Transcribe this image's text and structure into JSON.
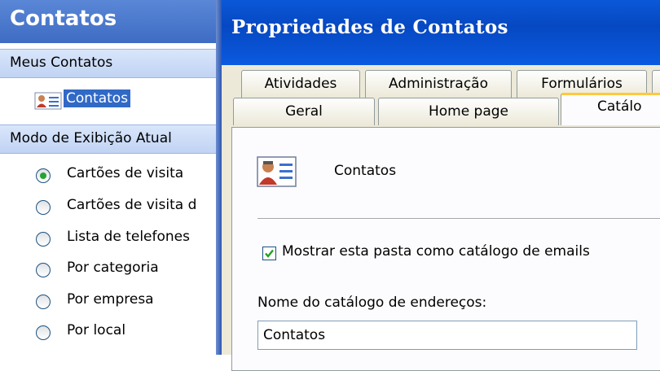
{
  "nav": {
    "title": "Contatos",
    "my_contacts_header": "Meus Contatos",
    "contacts_item": "Contatos",
    "current_view_header": "Modo de Exibição Atual",
    "views": [
      {
        "label": "Cartões de visita",
        "selected": true
      },
      {
        "label": "Cartões de visita d",
        "selected": false
      },
      {
        "label": "Lista de telefones",
        "selected": false
      },
      {
        "label": "Por categoria",
        "selected": false
      },
      {
        "label": "Por empresa",
        "selected": false
      },
      {
        "label": "Por local",
        "selected": false
      }
    ]
  },
  "dialog": {
    "title": "Propriedades de Contatos",
    "tabs_row1": [
      "Atividades",
      "Administração",
      "Formulários"
    ],
    "tabs_row2": [
      "Geral",
      "Home page",
      "Catálo"
    ],
    "active_tab": "Catálo",
    "folder_name": "Contatos",
    "show_as_catalog": {
      "label": "Mostrar esta pasta como catálogo de emails",
      "checked": true
    },
    "address_book_label": "Nome do catálogo de endereços:",
    "address_book_value": "Contatos"
  },
  "colors": {
    "nav_header": "#4a78cc",
    "dialog_titlebar": "#0a58d8",
    "selection": "#3169c6",
    "active_tab_accent": "#ffc83c",
    "checkmark": "#21a121"
  },
  "icons": {
    "contacts_folder": "contact-card-icon",
    "folder_large": "contact-card-large-icon",
    "check": "checkmark-icon"
  }
}
